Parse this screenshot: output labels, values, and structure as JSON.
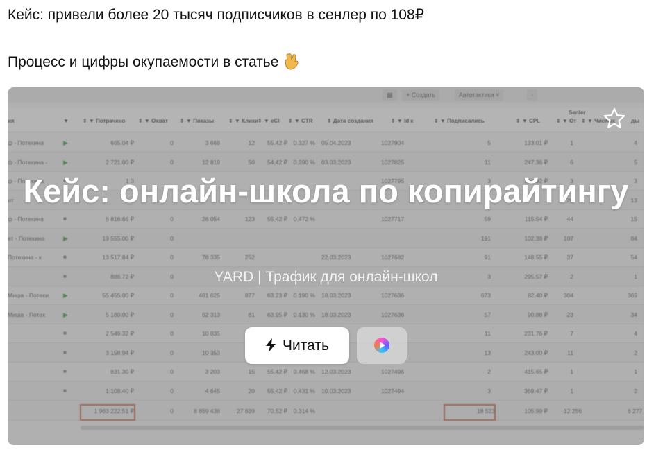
{
  "message": {
    "line1": "Кейс: привели более 20 тысяч подписчиков в сенлер по 108₽",
    "line2": "Процесс и цифры окупаемости в статье",
    "line2_emoji": "rock-on-hand-icon"
  },
  "card": {
    "title": "Кейс: онлайн-школа по копирайтингу",
    "subtitle": "YARD | Трафик для онлайн-школ",
    "read_label": "Читать",
    "read_icon": "lightning-bolt-icon",
    "video_icon": "video-play-orb-icon",
    "bookmark_icon": "star-outline-icon"
  },
  "sheet": {
    "toolbar": {
      "create": "+ Создать",
      "autotactics": "Автотактики ˅"
    },
    "group_label": "Senler",
    "headers": [
      "ия",
      "▼",
      "⇕ ▼ Потрачено",
      "⇕ ▼ Охват",
      "⇕ ▼ Показы",
      "⇕ ▼ Клики",
      "⇕ ▼ eCl",
      "⇕ ▼ CTR",
      "⇕ Дата создания",
      "⇕ ▼ Id к",
      "⇕ ▼ Подписались",
      "⇕ ▼ CPL",
      "⇕ ▼ От",
      "⇕ ▼ Чистых",
      "ды"
    ],
    "rows": [
      [
        "ф - Потехина",
        "▶",
        "665.04 ₽",
        "0",
        "3 668",
        "12",
        "55.42 ₽",
        "0.327 %",
        "05.04.2023",
        "1027904",
        "5",
        "133.01 ₽",
        "1",
        "4"
      ],
      [
        "ф - Потехина -",
        "▶",
        "2 721.00 ₽",
        "0",
        "12 819",
        "50",
        "54.42 ₽",
        "0.390 %",
        "03.03.2023",
        "1027825",
        "11",
        "247.36 ₽",
        "6",
        "5"
      ],
      [
        "ф - Потехина",
        "■",
        "1 3",
        "",
        "",
        "",
        "",
        "",
        "",
        "1027795",
        "3",
        "290.92 ₽",
        "3",
        "3"
      ],
      [
        "ит",
        "■",
        "5 0",
        "",
        "",
        "",
        "",
        "",
        "",
        "",
        "",
        "",
        "20",
        "13"
      ],
      [
        "ф - Потехина",
        "■",
        "6 816.66 ₽",
        "0",
        "26 054",
        "123",
        "55.42 ₽",
        "0.472 %",
        "",
        "1027717",
        "59",
        "115.54 ₽",
        "44",
        "15"
      ],
      [
        "ет - Потехина",
        "▶",
        "19 555.00 ₽",
        "0",
        "",
        "",
        "",
        "",
        "",
        "",
        "191",
        "102.38 ₽",
        "107",
        "84"
      ],
      [
        "Потехина - к",
        "■",
        "13 517.84 ₽",
        "0",
        "78 335",
        "252",
        "",
        "",
        "22.03.2023",
        "1027682",
        "91",
        "148.55 ₽",
        "37",
        "54"
      ],
      [
        "",
        "■",
        "886.72 ₽",
        "0",
        "",
        "",
        "",
        "",
        "",
        "",
        "3",
        "295.57 ₽",
        "2",
        "1"
      ],
      [
        "Миша - Потехи",
        "▶",
        "55 455.00 ₽",
        "0",
        "461 625",
        "877",
        "63.23 ₽",
        "0.190 %",
        "18.03.2023",
        "1027636",
        "673",
        "82.40 ₽",
        "304",
        "369"
      ],
      [
        "Миша - Потех",
        "▶",
        "5 180.00 ₽",
        "0",
        "62 313",
        "81",
        "63.95 ₽",
        "0.130 %",
        "18.03.2023",
        "1027636",
        "57",
        "90.88 ₽",
        "23",
        "34"
      ],
      [
        "",
        "■",
        "2 549.32 ₽",
        "0",
        "10 835",
        "",
        "",
        "",
        "",
        "",
        "11",
        "231.76 ₽",
        "7",
        "4"
      ],
      [
        "",
        "■",
        "3 158.94 ₽",
        "0",
        "10 353",
        "",
        "",
        "",
        "",
        "",
        "13",
        "243.00 ₽",
        "11",
        "2"
      ],
      [
        "",
        "■",
        "831.30 ₽",
        "0",
        "3 203",
        "15",
        "55.42 ₽",
        "0.468 %",
        "12.03.2023",
        "1027496",
        "2",
        "415.65 ₽",
        "1",
        "1"
      ],
      [
        "",
        "■",
        "1 108.40 ₽",
        "0",
        "4 645",
        "20",
        "55.42 ₽",
        "0.431 %",
        "10.03.2023",
        "1027494",
        "3",
        "369.47 ₽",
        "1",
        "2"
      ]
    ],
    "totals": [
      "",
      "",
      "1 963 222.51 ₽",
      "0",
      "8 859 438",
      "27 839",
      "70.52 ₽",
      "0.314 %",
      "",
      "",
      "18 523",
      "105.99 ₽",
      "12 256",
      "6 277"
    ]
  },
  "colors": {
    "highlight_box": "#c3684a",
    "play_green": "#3d9a3d",
    "overlay": "rgba(110,110,110,0.48)"
  }
}
